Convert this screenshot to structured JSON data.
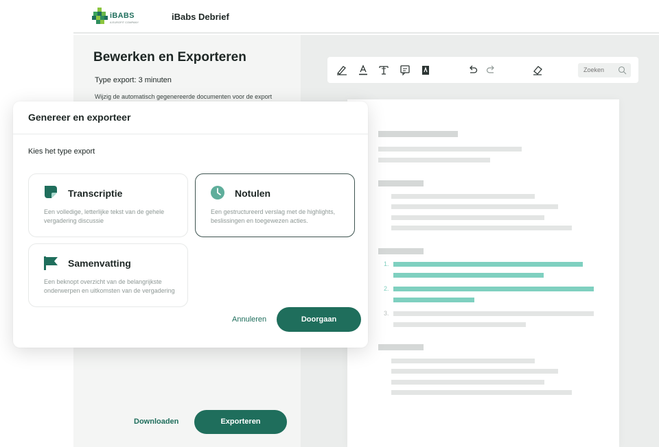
{
  "header": {
    "logo_name": "iBABS",
    "logo_sub": "A EUROFIT COMPANY",
    "app_title": "iBabs Debrief"
  },
  "left_panel": {
    "title": "Bewerken en Exporteren",
    "export_time": "Type export: 3 minuten",
    "description": "Wijzig de automatisch gegenereerde documenten voor de export",
    "download_label": "Downloaden",
    "export_label": "Exporteren"
  },
  "toolbar": {
    "tools": [
      "draw-icon",
      "text-color-icon",
      "text-style-icon",
      "comment-icon",
      "highlight-icon",
      "undo-icon",
      "redo-icon",
      "eraser-icon"
    ],
    "search_placeholder": "Zoeken"
  },
  "document": {
    "list_numbers": [
      "1.",
      "2.",
      "3."
    ]
  },
  "modal": {
    "title": "Genereer en exporteer",
    "subtitle": "Kies het type export",
    "options": [
      {
        "title": "Transcriptie",
        "description": "Een volledige, letterlijke tekst van de gehele vergadering discussie",
        "icon": "document-icon",
        "selected": false
      },
      {
        "title": "Notulen",
        "description": "Een gestructureerd verslag met de highlights, beslissingen en toegewezen acties.",
        "icon": "clock-icon",
        "selected": true
      },
      {
        "title": "Samenvatting",
        "description": "Een beknopt overzicht van de belangrijkste onderwerpen en uitkomsten van de vergadering",
        "icon": "flag-icon",
        "selected": false
      }
    ],
    "cancel_label": "Annuleren",
    "continue_label": "Doorgaan"
  },
  "colors": {
    "brand": "#1f6e5c",
    "highlight": "#7fd0c0",
    "panel": "#f4f5f4"
  }
}
